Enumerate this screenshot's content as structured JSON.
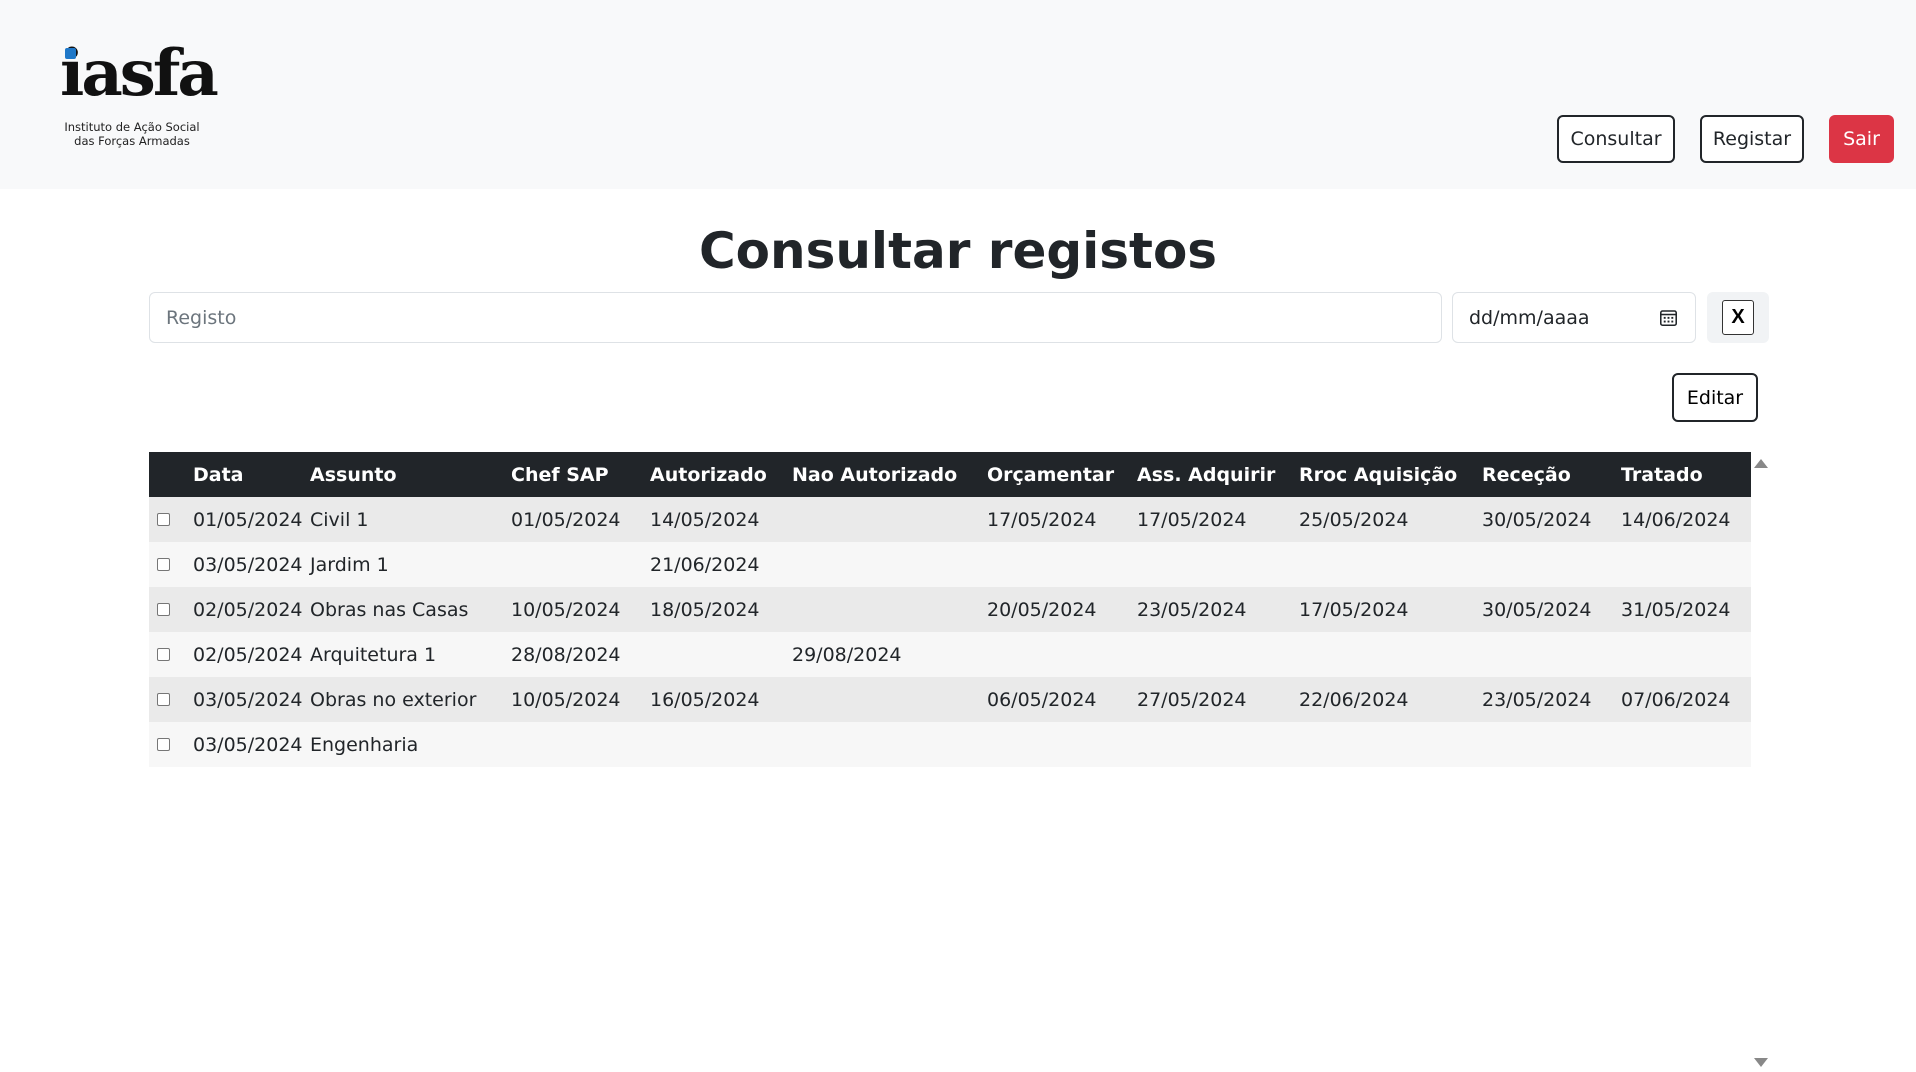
{
  "header": {
    "logo_text": "iasfa",
    "logo_subtitle_line1": "Instituto de Ação Social",
    "logo_subtitle_line2": "das Forças Armadas",
    "nav": {
      "consultar": "Consultar",
      "registar": "Registar",
      "sair": "Sair"
    }
  },
  "page_title": "Consultar registos",
  "filters": {
    "search_placeholder": "Registo",
    "date_placeholder": "dd/mm/aaaa",
    "clear_label": "X"
  },
  "actions": {
    "edit_label": "Editar"
  },
  "table": {
    "columns": [
      "Data",
      "Assunto",
      "Chef SAP",
      "Autorizado",
      "Nao Autorizado",
      "Orçamentar",
      "Ass. Adquirir",
      "Rroc Aquisição",
      "Receção",
      "Tratado"
    ],
    "rows": [
      [
        "01/05/2024",
        "Civil 1",
        "01/05/2024",
        "14/05/2024",
        "",
        "17/05/2024",
        "17/05/2024",
        "25/05/2024",
        "30/05/2024",
        "14/06/2024"
      ],
      [
        "03/05/2024",
        "Jardim 1",
        "",
        "21/06/2024",
        "",
        "",
        "",
        "",
        "",
        ""
      ],
      [
        "02/05/2024",
        "Obras nas Casas",
        "10/05/2024",
        "18/05/2024",
        "",
        "20/05/2024",
        "23/05/2024",
        "17/05/2024",
        "30/05/2024",
        "31/05/2024"
      ],
      [
        "02/05/2024",
        "Arquitetura 1",
        "28/08/2024",
        "",
        "29/08/2024",
        "",
        "",
        "",
        "",
        ""
      ],
      [
        "03/05/2024",
        "Obras no exterior",
        "10/05/2024",
        "16/05/2024",
        "",
        "06/05/2024",
        "27/05/2024",
        "22/06/2024",
        "23/05/2024",
        "07/06/2024"
      ],
      [
        "03/05/2024",
        "Engenharia",
        "",
        "",
        "",
        "",
        "",
        "",
        "",
        ""
      ]
    ]
  },
  "colors": {
    "header_bg": "#f8f9fa",
    "danger": "#dc3545",
    "table_head": "#212529",
    "logo_accent": "#1f78c8"
  }
}
